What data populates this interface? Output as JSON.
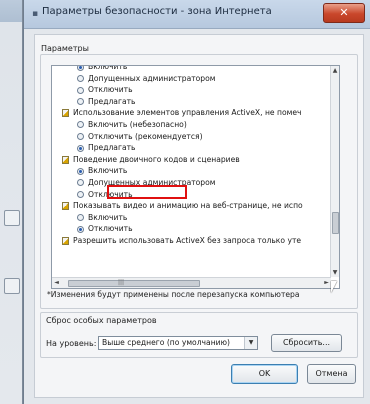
{
  "window": {
    "title": "Параметры безопасности - зона Интернета",
    "close_glyph": "✕"
  },
  "settings": {
    "group_label": "Параметры",
    "rows": [
      {
        "kind": "option",
        "label": "Включить",
        "selected": true
      },
      {
        "kind": "option",
        "label": "Допущенных администратором",
        "selected": false
      },
      {
        "kind": "option",
        "label": "Отключить",
        "selected": false
      },
      {
        "kind": "option",
        "label": "Предлагать",
        "selected": false
      },
      {
        "kind": "group",
        "label": "Использование элементов управления ActiveX, не помеч"
      },
      {
        "kind": "option",
        "label": "Включить (небезопасно)",
        "selected": false
      },
      {
        "kind": "option",
        "label": "Отключить (рекомендуется)",
        "selected": false
      },
      {
        "kind": "option",
        "label": "Предлагать",
        "selected": true,
        "highlighted": true
      },
      {
        "kind": "group",
        "label": "Поведение двоичного кодов и сценариев"
      },
      {
        "kind": "option",
        "label": "Включить",
        "selected": true
      },
      {
        "kind": "option",
        "label": "Допущенных администратором",
        "selected": false
      },
      {
        "kind": "option",
        "label": "Отключить",
        "selected": false
      },
      {
        "kind": "group",
        "label": "Показывать видео и анимацию на веб-странице, не испо"
      },
      {
        "kind": "option",
        "label": "Включить",
        "selected": false
      },
      {
        "kind": "option",
        "label": "Отключить",
        "selected": true
      },
      {
        "kind": "group",
        "label": "Разрешить использовать ActiveX без запроса только уте"
      }
    ]
  },
  "notice": "*Изменения будут применены после перезапуска компьютера",
  "reset": {
    "group_label": "Сброс особых параметров",
    "level_label": "На уровень:",
    "level_value": "Выше среднего (по умолчанию)",
    "reset_button": "Сбросить..."
  },
  "buttons": {
    "ok": "OK",
    "cancel": "Отмена"
  },
  "colors": {
    "highlight": "#e01010",
    "close": "#c9472b"
  }
}
